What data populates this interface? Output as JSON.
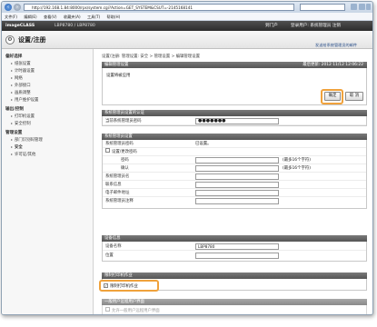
{
  "browser": {
    "url": "http://192.168.1.84:8000/rps/system.cgi?Action=GET_SYSTEM&CSUT=-2145168141",
    "menu": [
      "文件(F)",
      "编辑(E)",
      "查看(V)",
      "收藏夹(A)",
      "工具(T)",
      "帮助(H)"
    ]
  },
  "app": {
    "brand": "imageCLASS",
    "device": "LBP8780 / LBP8780",
    "portal_link": "到门户",
    "login_user": "登录用户: 系统管理员 注销",
    "page_title": "设置/注册",
    "mail_link": "发送给系统管理员的邮件"
  },
  "sidebar": {
    "groups": [
      {
        "title": "偏好选择",
        "items": [
          "纸张设置",
          "计时器设置",
          "网络",
          "外部接口",
          "画质调整",
          "用户维护设置"
        ]
      },
      {
        "title": "输出/控制",
        "items": [
          "打印机设置",
          "安全控制"
        ]
      },
      {
        "title": "管理设置",
        "items": [
          "部门识别码管理",
          "安全",
          "许可证/其他"
        ]
      }
    ]
  },
  "main": {
    "breadcrumb": "设置/注册: 管理设置: 安全 > 管理设置 > 编辑管理设置",
    "header_title": "编辑管理设置",
    "last_updated": "最后更新: 2012 11/12 12:06:22",
    "notice": "设置将被应用",
    "ok_label": "确定",
    "cancel_label": "取 消",
    "sec_auth": {
      "title": "系统管理员设置的认证",
      "row_label": "当前系统管理员密码",
      "row_value": "●●●●●●●"
    },
    "sec_admin": {
      "title": "系统管理员设置",
      "rows": [
        {
          "label": "系统管理员密码",
          "value": "已设置。"
        },
        {
          "label": "设置/更改密码",
          "value": ""
        },
        {
          "label": "密码",
          "value": "",
          "hint": "(最多16个字符)"
        },
        {
          "label": "确认",
          "value": "",
          "hint": "(最多16个字符)"
        },
        {
          "label": "系统管理员名",
          "value": ""
        },
        {
          "label": "联系信息",
          "value": ""
        },
        {
          "label": "电子邮件地址",
          "value": ""
        },
        {
          "label": "系统管理员注释",
          "value": ""
        }
      ]
    },
    "sec_device": {
      "title": "设备信息",
      "rows": [
        {
          "label": "设备名称",
          "value": "LBP8780"
        },
        {
          "label": "位置",
          "value": ""
        }
      ]
    },
    "sec_restrict": {
      "title": "限制打印机作业",
      "checkbox_label": "限制打印机作业",
      "checked": true
    },
    "sec_remote": {
      "title": "一般用户远程用户界面",
      "checkbox_label": "允许一般用户远程用户界面"
    }
  }
}
